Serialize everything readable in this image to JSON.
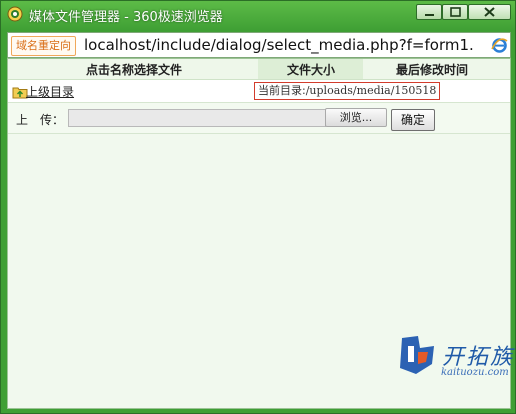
{
  "window": {
    "title": "媒体文件管理器 - 360极速浏览器"
  },
  "address_bar": {
    "redirect_badge": "域名重定向",
    "url": "localhost/include/dialog/select_media.php?f=form1."
  },
  "table": {
    "headers": {
      "name": "点击名称选择文件",
      "size": "文件大小",
      "mtime": "最后修改时间"
    },
    "parent_dir_label": "上级目录",
    "current_dir_label": "当前目录:",
    "current_dir_path": "/uploads/media/150518"
  },
  "upload": {
    "label": "上　传：",
    "browse_label": "浏览...",
    "ok_label": "确定"
  },
  "watermark": {
    "brand": "开拓族",
    "url": "kaituozu.com"
  },
  "colors": {
    "frame_green": "#3f9f34",
    "content_bg": "#f1f9ee",
    "current_dir_border": "#d23c2c",
    "redirect_badge": "#d96d16"
  }
}
